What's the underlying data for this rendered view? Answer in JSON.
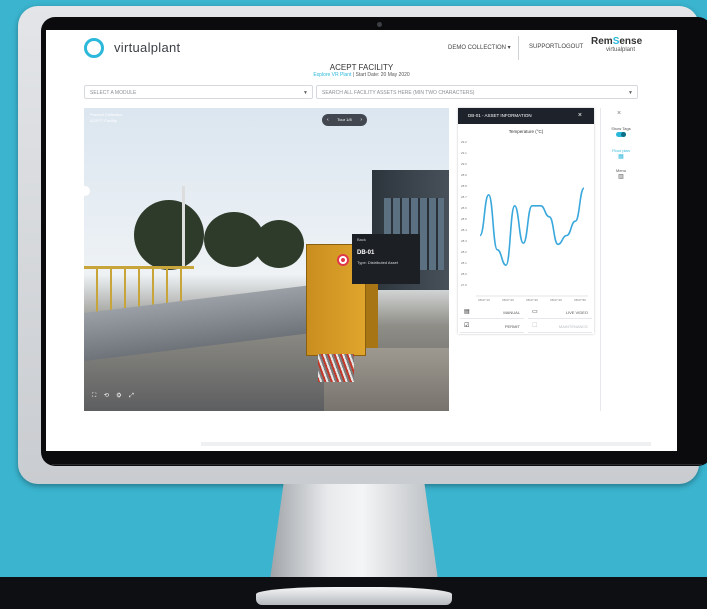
{
  "app": {
    "logo_text": "virtualplant",
    "nav": {
      "demo_collection": "DEMO COLLECTION ▾",
      "support": "SUPPORT",
      "logout": "LOGOUT"
    },
    "brand": {
      "name_part1": "Rem",
      "name_accent": "S",
      "name_part2": "ense",
      "sub": "virtualplant"
    }
  },
  "facility": {
    "title": "ACEPT FACILITY",
    "sub_link": "Explore VR Plant",
    "sub_date": "Start Date: 20 May 2020"
  },
  "filters": {
    "module_placeholder": "SELECT A MODULE",
    "search_placeholder": "SEARCH ALL FACILITY ASSETS HERE (MIN TWO CHARACTERS)"
  },
  "viewer": {
    "label_1": "Product Collection",
    "label_2": "ACEPT Facility",
    "tour_label": "Tour 1/8",
    "tooltip": {
      "header": "Back",
      "asset_id": "DB-01",
      "asset_type": "Type: Distributed Asset"
    },
    "controls": "⛶ ⟲ ⚙ ⤢"
  },
  "sensor_panel": {
    "header": "DB-01 - ASSET INFORMATION",
    "close_icon": "×",
    "buttons": [
      {
        "icon": "file-icon",
        "glyph": "▤",
        "label": "MANUAL",
        "enabled": true
      },
      {
        "icon": "monitor-icon",
        "glyph": "▭",
        "label": "LIVE VIDEO",
        "enabled": true
      },
      {
        "icon": "check-icon",
        "glyph": "☑",
        "label": "PERMIT",
        "enabled": true
      },
      {
        "icon": "maintenance-icon",
        "glyph": "☐",
        "label": "MAINTENANCE",
        "enabled": false
      }
    ]
  },
  "rail": {
    "close": "×",
    "show_tags_label": "Show Tags",
    "floor_plan_label": "Floor plan",
    "menu_label": "Menu"
  },
  "colors": {
    "accent": "#2cb8da",
    "line": "#3aa8dc",
    "panel_header": "#1d222b"
  },
  "chart_data": {
    "type": "line",
    "title": "Temperature (°C)",
    "ylim": [
      27.8,
      29.2
    ],
    "yticks": [
      29.2,
      29.1,
      29.0,
      28.9,
      28.8,
      28.7,
      28.6,
      28.5,
      28.4,
      28.3,
      28.2,
      28.1,
      28.0,
      27.9
    ],
    "xtick_labels": [
      "08:07:10",
      "08:07:20",
      "08:07:30",
      "08:07:40",
      "08:07:50"
    ],
    "series": [
      {
        "values": [
          28.35,
          28.72,
          28.22,
          28.08,
          28.62,
          28.28,
          28.62,
          28.62,
          28.52,
          28.27,
          28.35,
          28.48,
          28.78
        ]
      }
    ],
    "grid": false
  }
}
